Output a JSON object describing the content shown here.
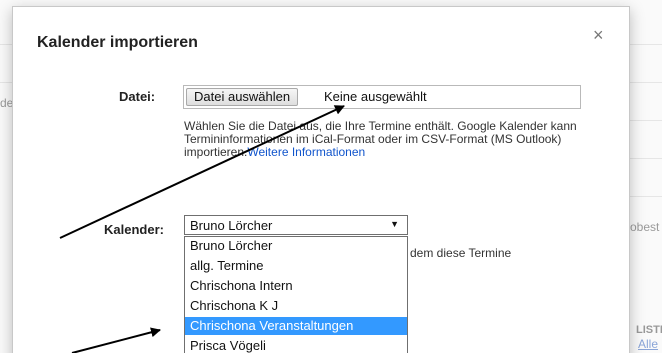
{
  "dialog": {
    "title": "Kalender importieren",
    "close_symbol": "×"
  },
  "file": {
    "label": "Datei:",
    "button_label": "Datei auswählen",
    "status": "Keine ausgewählt",
    "help_text": "Wählen Sie die Datei aus, die Ihre Termine enthält. Google Kalender kann Termininformationen im iCal-Format oder im CSV-Format (MS Outlook) importieren.",
    "help_link": "Weitere Informationen"
  },
  "calendar": {
    "label": "Kalender:",
    "selected": "Bruno Lörcher",
    "caret": "▼",
    "options": [
      "Bruno Lörcher",
      "allg. Termine",
      "Chrischona Intern",
      "Chrischona K J",
      "Chrischona Veranstaltungen",
      "Prisca Vögeli"
    ],
    "highlighted_index": 4,
    "aside_text": "dem diese Termine"
  },
  "background": {
    "left_fragment": "de",
    "right_fragment": "obest",
    "liste_fragment": "LISTE",
    "link_fragment": "Alle"
  },
  "colors": {
    "highlight": "#3399ff",
    "link": "#1155cc",
    "arrow": "#000000"
  }
}
